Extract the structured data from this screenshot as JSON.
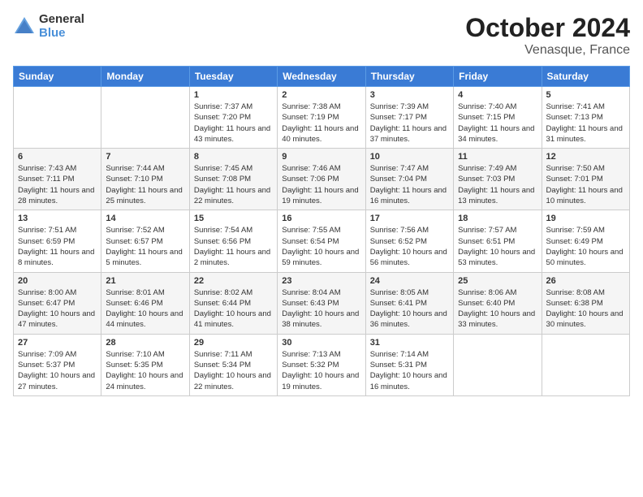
{
  "logo": {
    "line1": "General",
    "line2": "Blue"
  },
  "title": "October 2024",
  "subtitle": "Venasque, France",
  "days_of_week": [
    "Sunday",
    "Monday",
    "Tuesday",
    "Wednesday",
    "Thursday",
    "Friday",
    "Saturday"
  ],
  "weeks": [
    [
      {
        "num": "",
        "info": ""
      },
      {
        "num": "",
        "info": ""
      },
      {
        "num": "1",
        "info": "Sunrise: 7:37 AM\nSunset: 7:20 PM\nDaylight: 11 hours\nand 43 minutes."
      },
      {
        "num": "2",
        "info": "Sunrise: 7:38 AM\nSunset: 7:19 PM\nDaylight: 11 hours\nand 40 minutes."
      },
      {
        "num": "3",
        "info": "Sunrise: 7:39 AM\nSunset: 7:17 PM\nDaylight: 11 hours\nand 37 minutes."
      },
      {
        "num": "4",
        "info": "Sunrise: 7:40 AM\nSunset: 7:15 PM\nDaylight: 11 hours\nand 34 minutes."
      },
      {
        "num": "5",
        "info": "Sunrise: 7:41 AM\nSunset: 7:13 PM\nDaylight: 11 hours\nand 31 minutes."
      }
    ],
    [
      {
        "num": "6",
        "info": "Sunrise: 7:43 AM\nSunset: 7:11 PM\nDaylight: 11 hours\nand 28 minutes."
      },
      {
        "num": "7",
        "info": "Sunrise: 7:44 AM\nSunset: 7:10 PM\nDaylight: 11 hours\nand 25 minutes."
      },
      {
        "num": "8",
        "info": "Sunrise: 7:45 AM\nSunset: 7:08 PM\nDaylight: 11 hours\nand 22 minutes."
      },
      {
        "num": "9",
        "info": "Sunrise: 7:46 AM\nSunset: 7:06 PM\nDaylight: 11 hours\nand 19 minutes."
      },
      {
        "num": "10",
        "info": "Sunrise: 7:47 AM\nSunset: 7:04 PM\nDaylight: 11 hours\nand 16 minutes."
      },
      {
        "num": "11",
        "info": "Sunrise: 7:49 AM\nSunset: 7:03 PM\nDaylight: 11 hours\nand 13 minutes."
      },
      {
        "num": "12",
        "info": "Sunrise: 7:50 AM\nSunset: 7:01 PM\nDaylight: 11 hours\nand 10 minutes."
      }
    ],
    [
      {
        "num": "13",
        "info": "Sunrise: 7:51 AM\nSunset: 6:59 PM\nDaylight: 11 hours\nand 8 minutes."
      },
      {
        "num": "14",
        "info": "Sunrise: 7:52 AM\nSunset: 6:57 PM\nDaylight: 11 hours\nand 5 minutes."
      },
      {
        "num": "15",
        "info": "Sunrise: 7:54 AM\nSunset: 6:56 PM\nDaylight: 11 hours\nand 2 minutes."
      },
      {
        "num": "16",
        "info": "Sunrise: 7:55 AM\nSunset: 6:54 PM\nDaylight: 10 hours\nand 59 minutes."
      },
      {
        "num": "17",
        "info": "Sunrise: 7:56 AM\nSunset: 6:52 PM\nDaylight: 10 hours\nand 56 minutes."
      },
      {
        "num": "18",
        "info": "Sunrise: 7:57 AM\nSunset: 6:51 PM\nDaylight: 10 hours\nand 53 minutes."
      },
      {
        "num": "19",
        "info": "Sunrise: 7:59 AM\nSunset: 6:49 PM\nDaylight: 10 hours\nand 50 minutes."
      }
    ],
    [
      {
        "num": "20",
        "info": "Sunrise: 8:00 AM\nSunset: 6:47 PM\nDaylight: 10 hours\nand 47 minutes."
      },
      {
        "num": "21",
        "info": "Sunrise: 8:01 AM\nSunset: 6:46 PM\nDaylight: 10 hours\nand 44 minutes."
      },
      {
        "num": "22",
        "info": "Sunrise: 8:02 AM\nSunset: 6:44 PM\nDaylight: 10 hours\nand 41 minutes."
      },
      {
        "num": "23",
        "info": "Sunrise: 8:04 AM\nSunset: 6:43 PM\nDaylight: 10 hours\nand 38 minutes."
      },
      {
        "num": "24",
        "info": "Sunrise: 8:05 AM\nSunset: 6:41 PM\nDaylight: 10 hours\nand 36 minutes."
      },
      {
        "num": "25",
        "info": "Sunrise: 8:06 AM\nSunset: 6:40 PM\nDaylight: 10 hours\nand 33 minutes."
      },
      {
        "num": "26",
        "info": "Sunrise: 8:08 AM\nSunset: 6:38 PM\nDaylight: 10 hours\nand 30 minutes."
      }
    ],
    [
      {
        "num": "27",
        "info": "Sunrise: 7:09 AM\nSunset: 5:37 PM\nDaylight: 10 hours\nand 27 minutes."
      },
      {
        "num": "28",
        "info": "Sunrise: 7:10 AM\nSunset: 5:35 PM\nDaylight: 10 hours\nand 24 minutes."
      },
      {
        "num": "29",
        "info": "Sunrise: 7:11 AM\nSunset: 5:34 PM\nDaylight: 10 hours\nand 22 minutes."
      },
      {
        "num": "30",
        "info": "Sunrise: 7:13 AM\nSunset: 5:32 PM\nDaylight: 10 hours\nand 19 minutes."
      },
      {
        "num": "31",
        "info": "Sunrise: 7:14 AM\nSunset: 5:31 PM\nDaylight: 10 hours\nand 16 minutes."
      },
      {
        "num": "",
        "info": ""
      },
      {
        "num": "",
        "info": ""
      }
    ]
  ]
}
